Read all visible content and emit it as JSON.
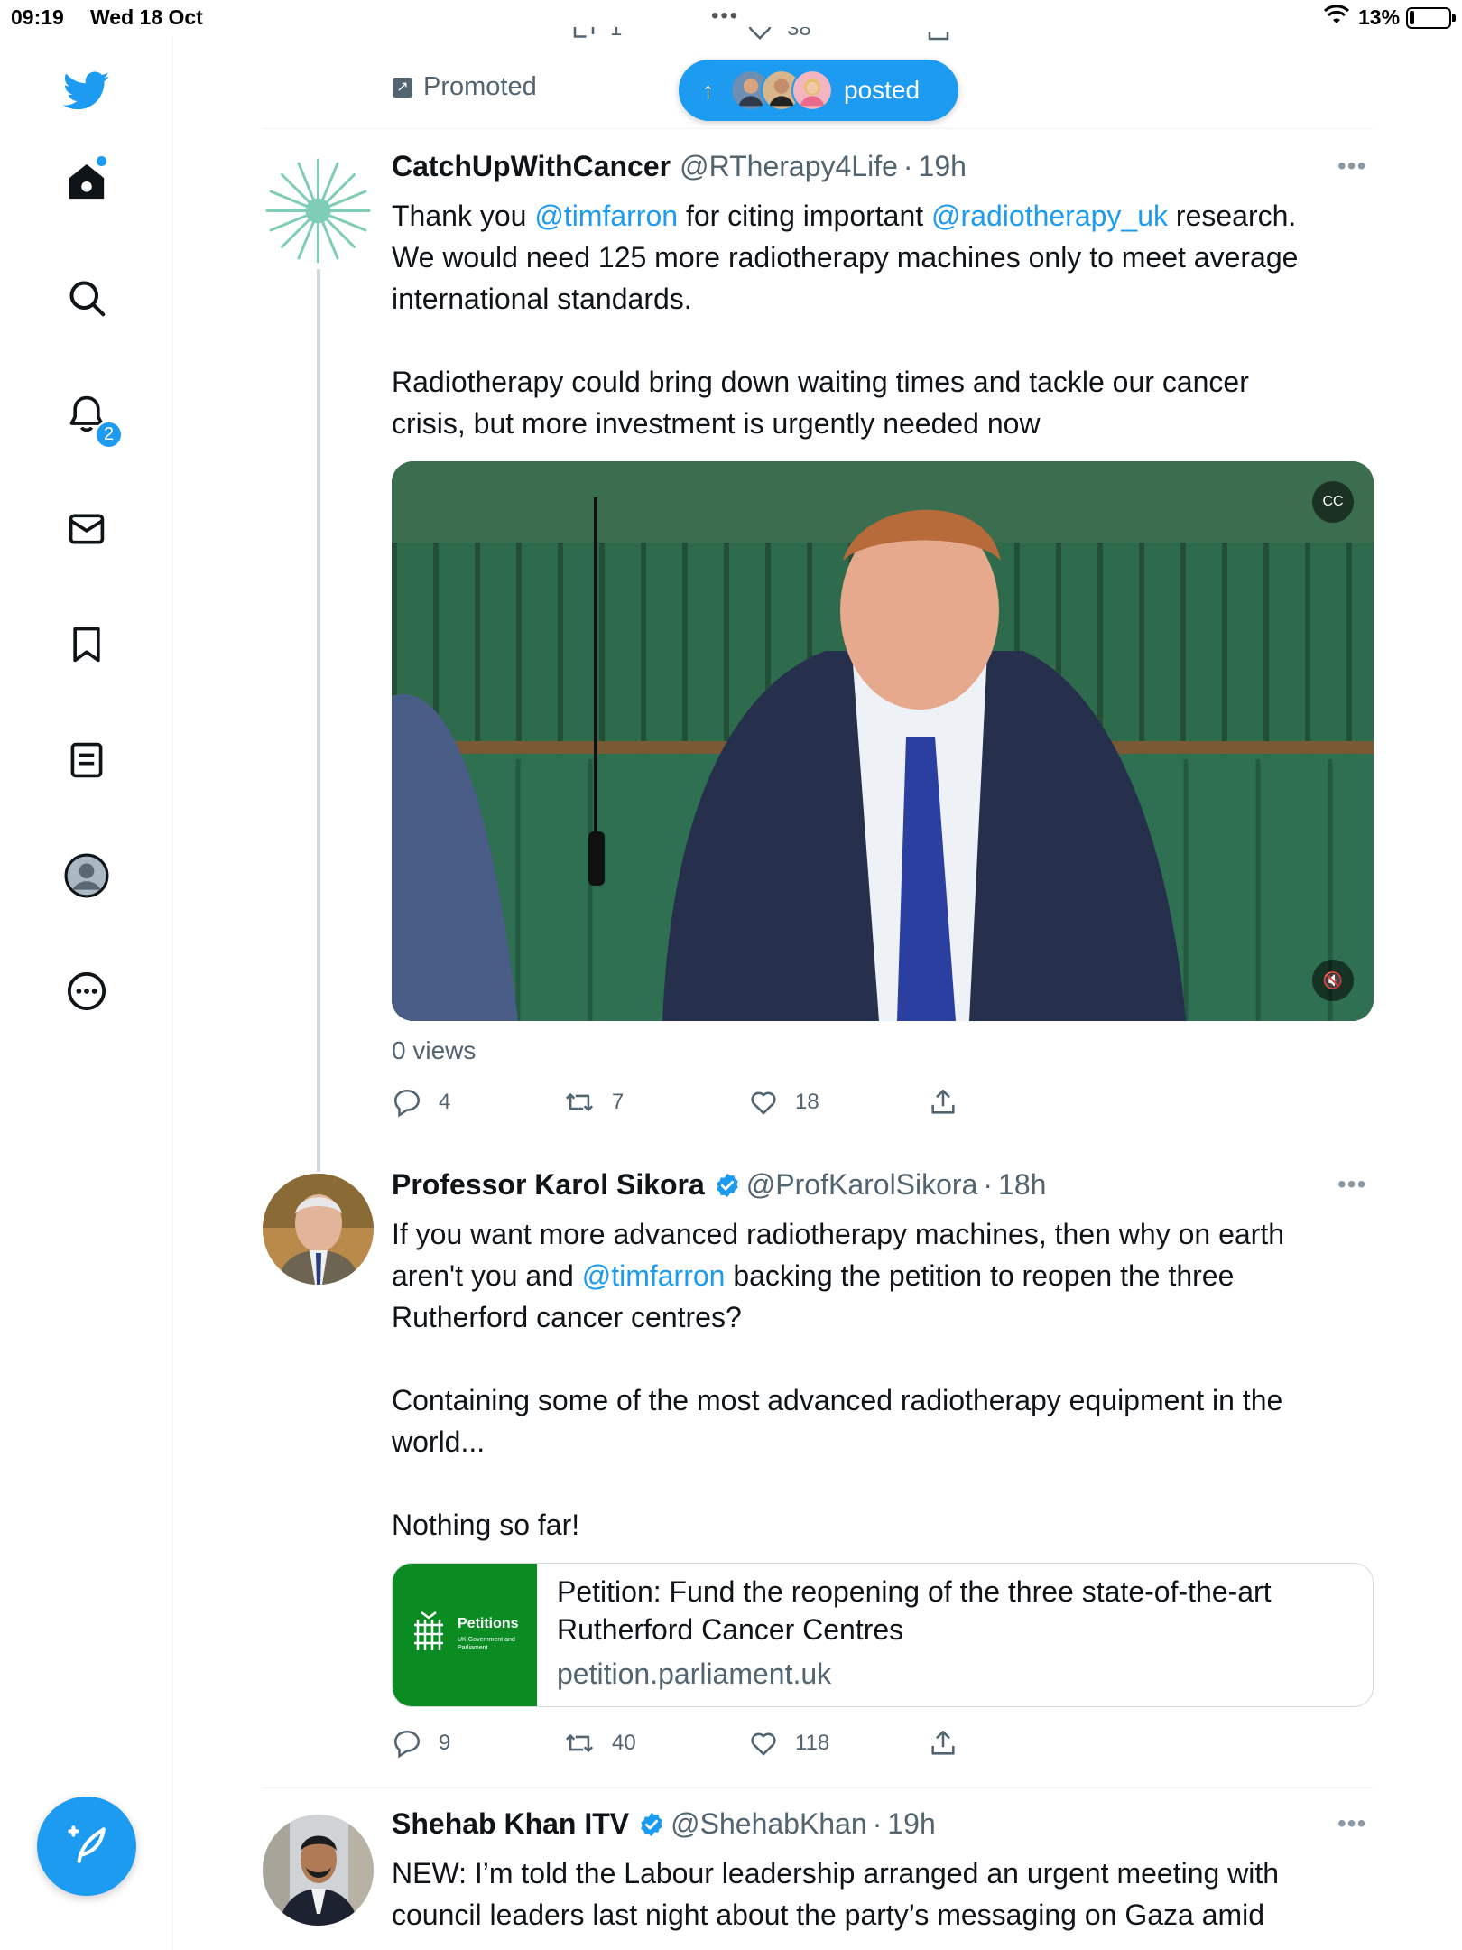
{
  "status_bar": {
    "time": "09:19",
    "date": "Wed 18 Oct",
    "battery": "13%",
    "battery_level": 0.13
  },
  "nav": {
    "items": [
      {
        "name": "home",
        "icon": "home-icon"
      },
      {
        "name": "explore",
        "icon": "search-icon"
      },
      {
        "name": "notifications",
        "icon": "bell-icon",
        "badge": "2"
      },
      {
        "name": "messages",
        "icon": "mail-icon"
      },
      {
        "name": "bookmarks",
        "icon": "bookmark-icon"
      },
      {
        "name": "lists",
        "icon": "list-icon"
      },
      {
        "name": "profile",
        "icon": "profile-icon"
      },
      {
        "name": "more",
        "icon": "more-circle-icon"
      }
    ],
    "notification_badge": "2"
  },
  "top_tweet": {
    "promoted_label": "Promoted",
    "retweets_partial": "1",
    "likes_partial": "38"
  },
  "posted_pill": {
    "label": "posted"
  },
  "tweets": [
    {
      "name": "CatchUpWithCancer",
      "handle": "@RTherapy4Life",
      "time": "19h",
      "text": {
        "p1_a": "Thank you ",
        "p1_mention1": "@timfarron",
        "p1_b": " for citing important ",
        "p1_mention2": "@radiotherapy_uk",
        "p1_c": " research. We would need 125 more radiotherapy machines only to meet average international standards.",
        "p2": "Radiotherapy could bring down waiting times and tackle our cancer crisis, but more investment is urgently needed now"
      },
      "views": "0 views",
      "replies": "4",
      "retweets": "7",
      "likes": "18"
    },
    {
      "name": "Professor Karol Sikora",
      "handle": "@ProfKarolSikora",
      "time": "18h",
      "verified": true,
      "text": {
        "p1_a": "If you want more advanced radiotherapy machines, then why on earth aren't you and ",
        "p1_mention": "@timfarron",
        "p1_b": " backing the petition to reopen the three Rutherford cancer centres?",
        "p2": "Containing some of the most advanced radiotherapy equipment in the world...",
        "p3": "Nothing so far!"
      },
      "card": {
        "title": "Petition: Fund the reopening of the three state-of-the-art Rutherford Cancer Centres",
        "domain": "petition.parliament.uk",
        "thumb_title": "Petitions",
        "thumb_subtitle": "UK Government and Parliament"
      },
      "replies": "9",
      "retweets": "40",
      "likes": "118"
    },
    {
      "name": "Shehab Khan ITV",
      "handle": "@ShehabKhan",
      "time": "19h",
      "verified": true,
      "text": {
        "p1": "NEW: I’m told the Labour leadership arranged an urgent meeting with council leaders last night about the party’s messaging on Gaza amid"
      }
    }
  ],
  "colors": {
    "accent": "#1d9bf0",
    "text": "#0f1419",
    "muted": "#536471",
    "petition_green": "#0a8c23"
  }
}
